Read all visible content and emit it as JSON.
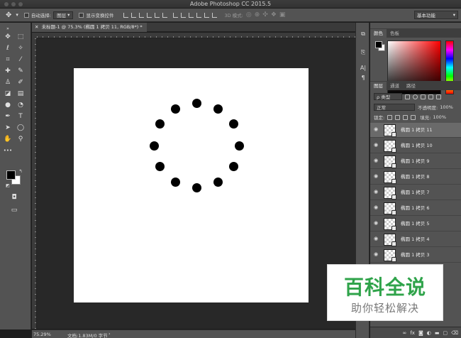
{
  "window": {
    "title": "Adobe Photoshop CC 2015.5"
  },
  "options_bar": {
    "auto_select_label": "自动选择:",
    "auto_select_value": "图层",
    "show_transform_label": "显示变换控件",
    "mode_3d_label": "3D 模式:",
    "workspace": "基本功能"
  },
  "document": {
    "tab_label": "未标题-1 @ 75.3% (椭圆 1 拷贝 11, RGB/8*) *"
  },
  "status_bar": {
    "zoom": "75.29%",
    "doc_info": "文档:1.83M/0 字节"
  },
  "color_panel": {
    "tabs": [
      "颜色",
      "色板"
    ],
    "fg": "#000000",
    "bg": "#ffffff"
  },
  "layers_panel": {
    "tabs": [
      "图层",
      "通道",
      "路径"
    ],
    "filter_kind": "ρ 类型",
    "blend_mode": "正常",
    "opacity_label": "不透明度:",
    "opacity_value": "100%",
    "lock_label": "锁定:",
    "fill_label": "填充:",
    "fill_value": "100%",
    "layers": [
      {
        "name": "椭圆 1 拷贝 11",
        "selected": true
      },
      {
        "name": "椭圆 1 拷贝 10",
        "selected": false
      },
      {
        "name": "椭圆 1 拷贝 9",
        "selected": false
      },
      {
        "name": "椭圆 1 拷贝 8",
        "selected": false
      },
      {
        "name": "椭圆 1 拷贝 7",
        "selected": false
      },
      {
        "name": "椭圆 1 拷贝 6",
        "selected": false
      },
      {
        "name": "椭圆 1 拷贝 5",
        "selected": false
      },
      {
        "name": "椭圆 1 拷贝 4",
        "selected": false
      },
      {
        "name": "椭圆 1 拷贝 3",
        "selected": false
      }
    ],
    "footer_icons": [
      "link-icon",
      "fx-icon",
      "mask-icon",
      "adjustment-icon",
      "group-icon",
      "new-layer-icon",
      "trash-icon"
    ]
  },
  "watermark": {
    "title": "百科全说",
    "subtitle": "助你轻松解决"
  },
  "accent": {
    "watermark_green": "#2fa34a"
  }
}
